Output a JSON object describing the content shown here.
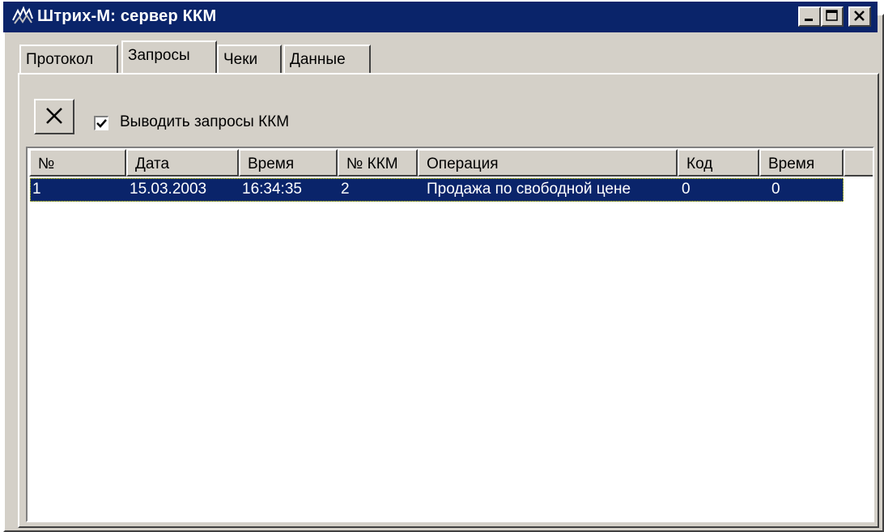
{
  "window": {
    "title": "Штрих-М: сервер ККМ",
    "icon": "app-logo-icon",
    "controls": [
      "minimize-icon",
      "maximize-icon",
      "close-icon"
    ]
  },
  "tabs": [
    {
      "label": "Протокол",
      "active": false
    },
    {
      "label": "Запросы",
      "active": true
    },
    {
      "label": "Чеки",
      "active": false
    },
    {
      "label": "Данные",
      "active": false
    }
  ],
  "toolbar": {
    "clear_icon": "clear-x-icon",
    "checkbox_label": "Выводить запросы ККМ",
    "checkbox_checked": true
  },
  "table": {
    "columns": [
      "№",
      "Дата",
      "Время",
      "№ ККМ",
      "Операция",
      "Код",
      "Время"
    ],
    "rows": [
      {
        "num": "1",
        "date": "15.03.2003",
        "time": "16:34:35",
        "kkm": "2",
        "operation": "Продажа по свободной цене",
        "code": "0",
        "duration": "0",
        "selected": true
      }
    ]
  },
  "colors": {
    "titlebar": "#0a246a",
    "face": "#d4d0c8",
    "selection": "#0a246a"
  }
}
